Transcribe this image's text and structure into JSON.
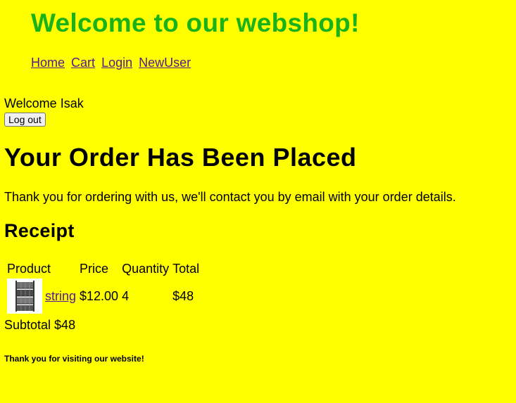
{
  "header": {
    "title": "Welcome to our webshop!",
    "nav": [
      "Home",
      "Cart",
      "Login",
      "NewUser"
    ]
  },
  "user": {
    "welcome": "Welcome Isak",
    "logout_label": "Log out"
  },
  "order": {
    "heading": "Your Order Has Been Placed",
    "message": "Thank you for ordering with us, we'll contact you by email with your order details."
  },
  "receipt": {
    "heading": "Receipt",
    "columns": [
      "Product",
      "Price",
      "Quantity",
      "Total"
    ],
    "rows": [
      {
        "product": "string",
        "price": "$12.00",
        "quantity": "4",
        "total": "$48",
        "image_icon": "shelf-rack-image"
      }
    ],
    "subtotal": "Subtotal $48"
  },
  "footer": {
    "text": "Thank you for visiting our website!"
  },
  "colors": {
    "background": "#ffff00",
    "title": "#19b319",
    "link": "#551a8b"
  }
}
